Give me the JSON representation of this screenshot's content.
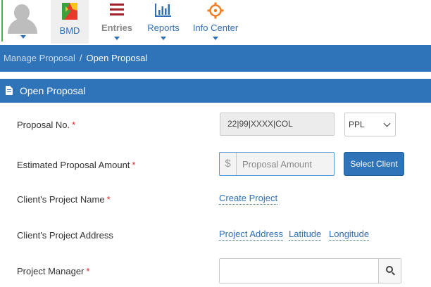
{
  "nav": {
    "bmd_label": "BMD",
    "entries_label": "Entries",
    "reports_label": "Reports",
    "info_label": "Info Center"
  },
  "breadcrumb": {
    "parent": "Manage Proposal",
    "separator": "/",
    "current": "Open Proposal"
  },
  "panel": {
    "title": "Open Proposal"
  },
  "form": {
    "proposal_no_label": "Proposal No.",
    "proposal_no_value": "22|99|XXXX|COL",
    "proposal_type_selected": "PPL",
    "amount_label": "Estimated Proposal Amount",
    "currency_symbol": "$",
    "amount_placeholder": "Proposal Amount",
    "select_client_label": "Select Client",
    "project_name_label": "Client's Project Name",
    "create_project_link": "Create Project",
    "project_address_label": "Client's Project Address",
    "project_address_link": "Project Address",
    "latitude_link": "Latitude",
    "longitude_link": "Longitude",
    "project_manager_label": "Project Manager",
    "required_mark": "*"
  },
  "colors": {
    "primary": "#2f74b8",
    "required": "#d9242b",
    "link": "#2e6fb5"
  },
  "icons": [
    "avatar",
    "bmd-logo-icon",
    "entries-menu-icon",
    "reports-chart-icon",
    "info-center-icon",
    "document-icon",
    "search-icon",
    "chevron-down-icon"
  ]
}
